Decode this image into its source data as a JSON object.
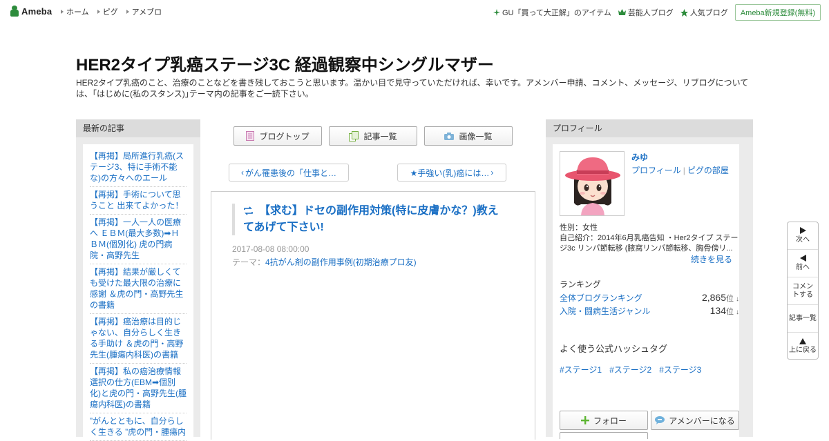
{
  "global_nav": {
    "logo": "Ameba",
    "items": [
      "ホーム",
      "ピグ",
      "アメブロ"
    ],
    "right_items": [
      "GU「買って大正解」のアイテム",
      "芸能人ブログ",
      "人気ブログ"
    ],
    "signup": "Ameba新規登録(無料)"
  },
  "blog": {
    "title": "HER2タイプ乳癌ステージ3C 経過観察中シングルマザー",
    "description": "HER2タイプ乳癌のこと、治療のことなどを書き残しておこうと思います。温かい目で見守っていただければ、幸いです。アメンバー申請、コメント、メッセージ、リブログについては、｢はじめに(私のスタンス)｣テーマ内の記事をご一読下さい。"
  },
  "left": {
    "heading": "最新の記事",
    "entries": [
      "【再掲】局所進行乳癌(ステージ3、特に手術不能な)の方々へのエール",
      "【再掲】手術について思うこと 出来てよかった！",
      "【再掲】一人一人の医療へ ＥＢＭ(最大多数)➡ＨＢＭ(個別化) 虎の門病院・高野先生",
      "【再掲】結果が厳しくても受けた最大限の治療に感謝 ＆虎の門・高野先生の書籍",
      "【再掲】癌治療は目的じゃない、自分らしく生きる手助け ＆虎の門・高野先生(腫瘍内科医)の書籍",
      "【再掲】私の癌治療情報選択の仕方(EBM➡個別化)と虎の門・高野先生(腫瘍内科医)の書籍",
      "”がんとともに、自分らしく生きる ”虎の門・腫瘍内"
    ]
  },
  "center": {
    "nav_buttons": [
      "ブログトップ",
      "記事一覧",
      "画像一覧"
    ],
    "prev_article": "がん罹患後の「仕事と…",
    "next_article": "★手強い(乳)癌には…",
    "article": {
      "title": "【求む】ドセの副作用対策(特に皮膚かな？)教えてあげて下さい!",
      "date": "2017-08-08 08:00:00",
      "theme_label": "テーマ：",
      "theme": "4抗がん剤の副作用事例(初期治療プロ友)"
    }
  },
  "right": {
    "heading": "プロフィール",
    "name": "みゆ",
    "links": [
      "プロフィール",
      "ピグの部屋"
    ],
    "gender": "性別：女性",
    "intro": "自己紹介：2014年6月乳癌告知 ・Her2タイプ ステージ3c リンパ節転移 (腋窩リンパ節転移、胸骨傍リ...",
    "more": "続きを見る",
    "ranking_title": "ランキング",
    "rankings": [
      {
        "label": "全体ブログランキング",
        "value": "2,865",
        "unit": "位",
        "arrow": "↓"
      },
      {
        "label": "入院・闘病生活ジャンル",
        "value": "134",
        "unit": "位",
        "arrow": "↓"
      }
    ],
    "hashtag_title": "よく使う公式ハッシュタグ",
    "hashtags": [
      "#ステージ1",
      "#ステージ2",
      "#ステージ3"
    ],
    "follow": "フォロー",
    "amember": "アメンバーになる"
  },
  "side_nav": {
    "next": "次へ",
    "prev": "前へ",
    "comment": "コメントする",
    "list": "記事一覧",
    "top": "上に戻る"
  },
  "colors": {
    "link": "#1a6fc4",
    "brand_green": "#2d8c3c",
    "sidebar_bg": "#ebebeb",
    "follow_plus": "#5cb531"
  }
}
